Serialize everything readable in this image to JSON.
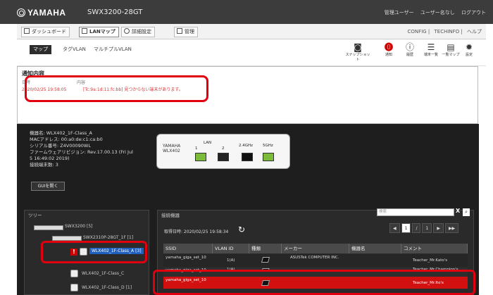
{
  "header": {
    "brand": "YAMAHA",
    "model": "SWX3200-28GT",
    "user_links": [
      "管理ユーザー",
      "ユーザー名なし",
      "ログアウト"
    ]
  },
  "tabs": [
    {
      "label": "ダッシュボード",
      "icon": "dashboard-icon"
    },
    {
      "label": "LANマップ",
      "icon": "lan-map-icon",
      "active": true
    },
    {
      "label": "詳細設定",
      "icon": "gear-icon"
    },
    {
      "label": "管理",
      "icon": "wrench-icon"
    }
  ],
  "right_links": [
    "CONFIG",
    "TECHINFO",
    "ヘルプ"
  ],
  "subtabs": [
    {
      "label": "マップ",
      "active": true
    },
    {
      "label": "タグVLAN"
    },
    {
      "label": "マルチプルVLAN"
    }
  ],
  "tools": [
    {
      "label": "スナップショット",
      "icon": "camera-icon"
    },
    {
      "label": "通知",
      "icon": "alert-icon",
      "alert": true
    },
    {
      "label": "履歴",
      "icon": "info-icon"
    },
    {
      "label": "端末一覧",
      "icon": "list-icon"
    },
    {
      "label": "一覧マップ",
      "icon": "map-icon"
    },
    {
      "label": "設定",
      "icon": "gear-icon"
    }
  ],
  "notice": {
    "title": "通知内容",
    "col_date": "日時",
    "col_content": "内容",
    "rows": [
      {
        "date": "2020/02/25 19:58:05",
        "content": "[Tc:9a:1d:11:fc:bb] 見つからない端末があります。"
      }
    ]
  },
  "device": {
    "lines": [
      "機器名: WLX402_1F-Class_A",
      "MACアドレス: 00:a0:de:c1:ca:b0",
      "シリアル番号: Z4V00090WL",
      "ファームウェアリビジョン: Rev.17.00.13 (Fri Jul",
      "5 16:49:02 2019)",
      "接続端末数: 3"
    ],
    "ap_brand": "YAMAHA",
    "ap_model": "WLX402",
    "lan_label": "LAN",
    "port1": "1",
    "port2": "2",
    "band1": "2.4GHz",
    "band2": "5GHz",
    "gui_button": "GUIを開く"
  },
  "tree": {
    "title": "ツリー",
    "items": [
      "SWX3200 [5]",
      "SWX2310P-28GT_1F [1]",
      "WLX402_1F-Class_A [3]",
      "WLX402_1F-Class_C",
      "WLX402_1F-Class_D [1]"
    ]
  },
  "connected": {
    "title": "接続機器",
    "search_placeholder": "検索",
    "search_clear": "X",
    "search_icon": "search-icon",
    "updated": "取得日時: 2020/02/25 19:58:34",
    "pager": {
      "prev": "◀",
      "current": "1",
      "sep": "/",
      "total": "1",
      "next": "▶",
      "last": "▶▶"
    },
    "columns": [
      "SSID",
      "VLAN ID",
      "種類",
      "メーカー",
      "機器名",
      "コメント"
    ],
    "rows": [
      {
        "ssid": "yamaha_giga_set_10",
        "vlan": "1(A)",
        "maker": "ASUSTek COMPUTER INC.",
        "name": "",
        "comment": "Teacher_Mr.Kato's"
      },
      {
        "ssid": "yamaha_giga_set_10",
        "vlan": "1(A)",
        "maker": "",
        "name": "",
        "comment": "Teacher_Mr.Champion's"
      },
      {
        "ssid": "yamaha_giga_set_10",
        "vlan": "",
        "maker": "",
        "name": "",
        "comment": "Teacher_Mr.Ito's",
        "selected": true
      }
    ]
  }
}
